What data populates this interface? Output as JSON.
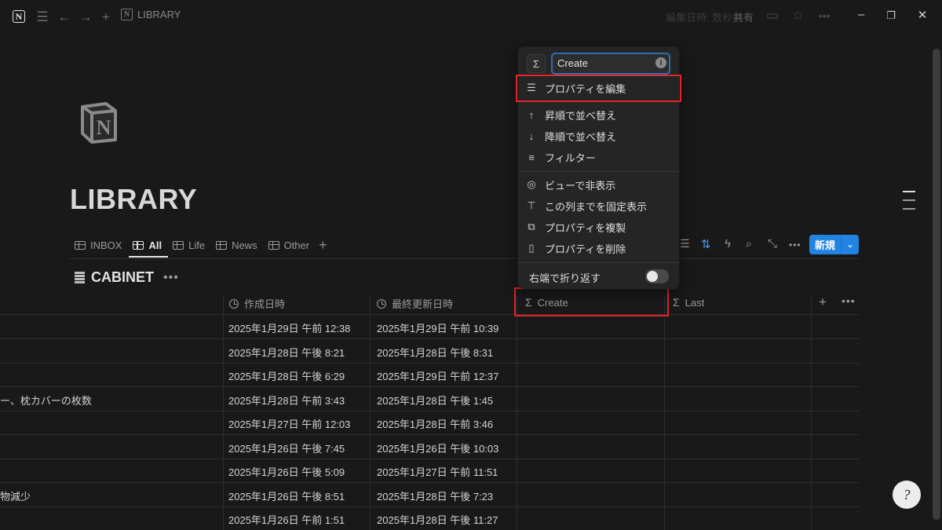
{
  "titlebar": {
    "breadcrumb": "LIBRARY",
    "edited": "編集日時: 数秒前",
    "share": "共有"
  },
  "page": {
    "title": "LIBRARY"
  },
  "tabs": [
    {
      "label": "INBOX",
      "active": false
    },
    {
      "label": "All",
      "active": true
    },
    {
      "label": "Life",
      "active": false
    },
    {
      "label": "News",
      "active": false
    },
    {
      "label": "Other",
      "active": false
    }
  ],
  "toolbar": {
    "new_label": "新規"
  },
  "database": {
    "name": "CABINET"
  },
  "columns": [
    {
      "label": "作成日時",
      "icon": "clock-icon"
    },
    {
      "label": "最終更新日時",
      "icon": "clock-icon"
    },
    {
      "label": "Create",
      "icon": "sigma-icon"
    },
    {
      "label": "Last",
      "icon": "sigma-icon"
    }
  ],
  "rows": [
    {
      "name": "",
      "created": "2025年1月29日 午前 12:38",
      "updated": "2025年1月29日 午前 10:39"
    },
    {
      "name": "",
      "created": "2025年1月28日 午後 8:21",
      "updated": "2025年1月28日 午後 8:31"
    },
    {
      "name": "",
      "created": "2025年1月28日 午後 6:29",
      "updated": "2025年1月29日 午前 12:37"
    },
    {
      "name": "ー、枕カバーの枚数",
      "created": "2025年1月28日 午前 3:43",
      "updated": "2025年1月28日 午後 1:45"
    },
    {
      "name": "",
      "created": "2025年1月27日 午前 12:03",
      "updated": "2025年1月28日 午前 3:46"
    },
    {
      "name": "",
      "created": "2025年1月26日 午後 7:45",
      "updated": "2025年1月26日 午後 10:03"
    },
    {
      "name": "",
      "created": "2025年1月26日 午後 5:09",
      "updated": "2025年1月27日 午前 11:51"
    },
    {
      "name": "物減少",
      "created": "2025年1月26日 午後 8:51",
      "updated": "2025年1月28日 午後 7:23"
    },
    {
      "name": "",
      "created": "2025年1月26日 午前 1:51",
      "updated": "2025年1月28日 午後 11:27"
    }
  ],
  "menu": {
    "input_value": "Create",
    "items": [
      {
        "label": "プロパティを編集",
        "icon": "sliders-icon"
      },
      {
        "label": "昇順で並べ替え",
        "icon": "arrow-up-icon"
      },
      {
        "label": "降順で並べ替え",
        "icon": "arrow-down-icon"
      },
      {
        "label": "フィルター",
        "icon": "filter-icon"
      },
      {
        "label": "ビューで非表示",
        "icon": "eye-off-icon"
      },
      {
        "label": "この列までを固定表示",
        "icon": "pin-icon"
      },
      {
        "label": "プロパティを複製",
        "icon": "duplicate-icon"
      },
      {
        "label": "プロパティを削除",
        "icon": "trash-icon"
      }
    ],
    "wrap_label": "右端で折り返す",
    "wrap_enabled": false
  },
  "colors": {
    "background": "#191919",
    "accent": "#2383e2",
    "highlight": "#e0252b"
  }
}
